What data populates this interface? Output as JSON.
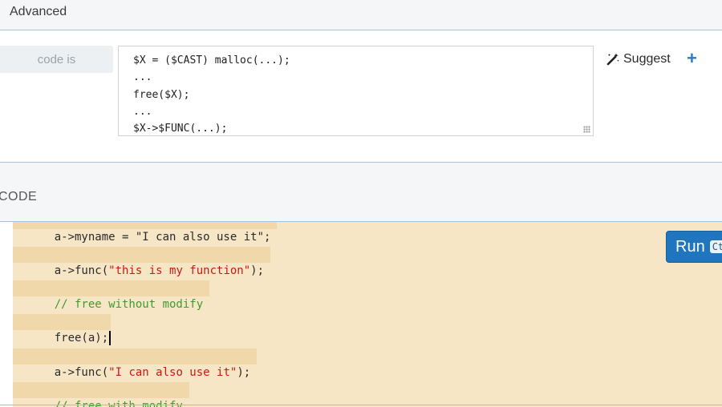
{
  "advanced": {
    "title": "Advanced"
  },
  "rule": {
    "label": "code is",
    "pattern_lines": [
      "$X = ($CAST) malloc(...);",
      "...",
      "free($X);",
      "...",
      "$X->$FUNC(...);"
    ],
    "suggest_label": "Suggest",
    "add_symbol": "+"
  },
  "code_section": {
    "title": "CODE"
  },
  "editor": {
    "partial_top_line": "a->myname = \"I can also use it\";",
    "lines": [
      {
        "id": "l1",
        "parts": [
          {
            "t": "plain",
            "v": "a->func("
          },
          {
            "t": "str",
            "v": "\"this is my function\""
          },
          {
            "t": "plain",
            "v": ");"
          }
        ]
      },
      {
        "id": "l2",
        "parts": [
          {
            "t": "cmt",
            "v": "// free without modify"
          }
        ]
      },
      {
        "id": "l3",
        "parts": [
          {
            "t": "plain",
            "v": "free(a);"
          }
        ]
      },
      {
        "id": "l4",
        "parts": [
          {
            "t": "plain",
            "v": "a->func("
          },
          {
            "t": "str",
            "v": "\"I can also use it\""
          },
          {
            "t": "plain",
            "v": ");"
          }
        ]
      },
      {
        "id": "l5",
        "parts": [
          {
            "t": "cmt",
            "v": "// free with modify"
          }
        ]
      }
    ]
  },
  "run_button": {
    "label": "Run",
    "shortcut": "Ct"
  },
  "colors": {
    "accent": "#1f76bf",
    "highlight": "#f0d8aa",
    "editor_bg": "#f7e6c6",
    "string": "#c41a16",
    "comment": "#3f9a2f"
  }
}
